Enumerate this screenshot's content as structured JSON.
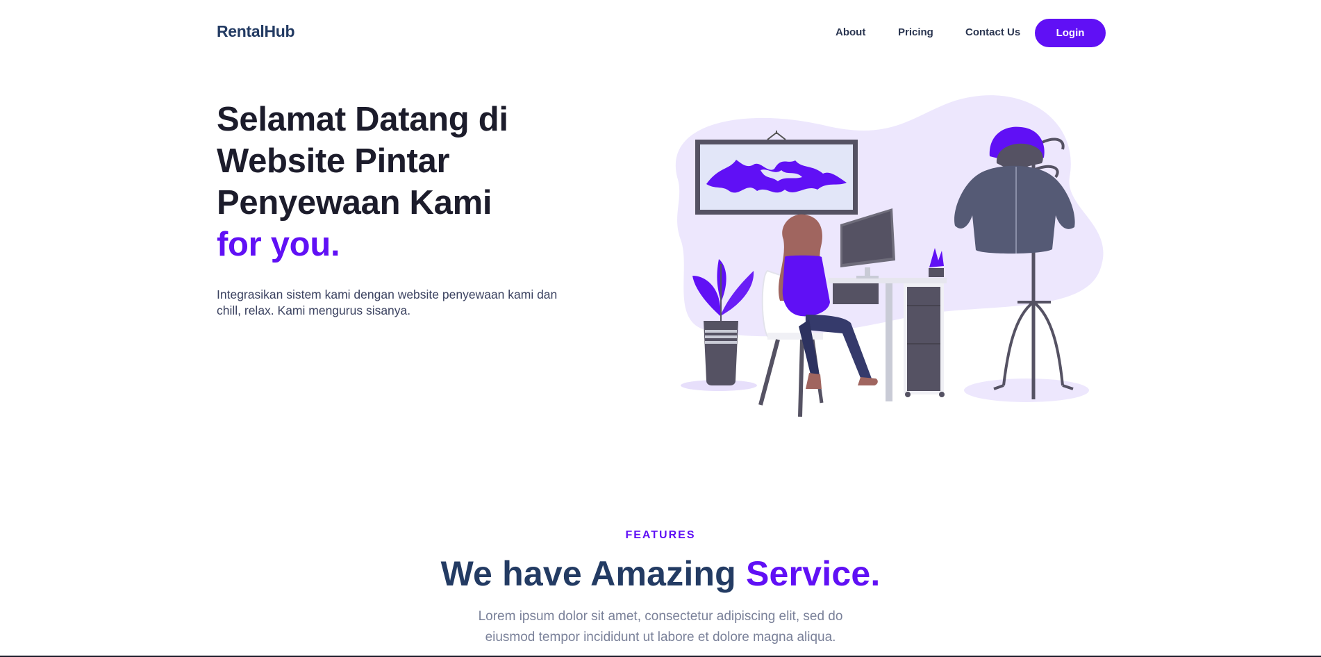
{
  "brand": "RentalHub",
  "nav": {
    "links": [
      "About",
      "Pricing",
      "Contact Us"
    ],
    "login_label": "Login"
  },
  "hero": {
    "title_lines": [
      "Selamat Datang di",
      "Website Pintar",
      "Penyewaan Kami"
    ],
    "title_accent": "for you.",
    "description": "Integrasikan sistem kami dengan website penyewaan kami dan chill, relax. Kami mengurus sisanya."
  },
  "features": {
    "tag": "FEATURES",
    "title_main": "We have Amazing ",
    "title_accent": "Service.",
    "description": "Lorem ipsum dolor sit amet, consectetur adipiscing elit, sed do eiusmod tempor incididunt ut labore et dolore magna aliqua."
  },
  "colors": {
    "accent": "#6010f5",
    "heading": "#1c1c2b",
    "brand": "#233b63",
    "blob": "#ede7fd"
  }
}
